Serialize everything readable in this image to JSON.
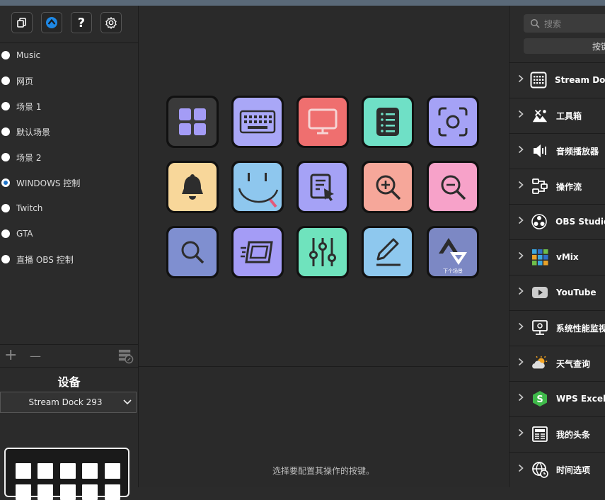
{
  "toolbar": {
    "buttons": [
      {
        "name": "copy-icon"
      },
      {
        "name": "store-icon"
      },
      {
        "name": "help-icon",
        "glyph": "?"
      },
      {
        "name": "gear-icon"
      }
    ]
  },
  "profiles": [
    {
      "label": "Music",
      "selected": false
    },
    {
      "label": "网页",
      "selected": false
    },
    {
      "label": "场景 1",
      "selected": false
    },
    {
      "label": "默认场景",
      "selected": false
    },
    {
      "label": "场景 2",
      "selected": false
    },
    {
      "label": "WINDOWS 控制",
      "selected": true
    },
    {
      "label": "Twitch",
      "selected": false
    },
    {
      "label": "GTA",
      "selected": false
    },
    {
      "label": "直播 OBS 控制",
      "selected": false
    }
  ],
  "profile_actions": {
    "add": "+",
    "remove": "—"
  },
  "device": {
    "title": "设备",
    "selected": "Stream Dock 293"
  },
  "keys": [
    {
      "icon": "grid-icon",
      "color": "#3a3a3a"
    },
    {
      "icon": "keyboard-icon",
      "color": "#a9a7f7"
    },
    {
      "icon": "monitor-icon",
      "color": "#ef6f6f"
    },
    {
      "icon": "list-icon",
      "color": "#6fe0c6"
    },
    {
      "icon": "screenshot-icon",
      "color": "#a5a2f6"
    },
    {
      "icon": "bell-icon",
      "color": "#f8d79a"
    },
    {
      "icon": "smiley-icon",
      "color": "#8ec7ee"
    },
    {
      "icon": "edit-pointer-icon",
      "color": "#a5a2f6"
    },
    {
      "icon": "zoom-in-icon",
      "color": "#f6a79a"
    },
    {
      "icon": "zoom-out-icon",
      "color": "#f7a2c9"
    },
    {
      "icon": "search-icon",
      "color": "#7f8fd0"
    },
    {
      "icon": "fast-window-icon",
      "color": "#a49cf6"
    },
    {
      "icon": "sliders-icon",
      "color": "#6fe3bd"
    },
    {
      "icon": "pencil-icon",
      "color": "#8ec8ee"
    },
    {
      "icon": "next-scene-icon",
      "color": "#7c88c4",
      "label": "下个场景"
    }
  ],
  "center_hint": "选择要配置其操作的按键。",
  "search": {
    "placeholder": "搜索",
    "button_label": "按键"
  },
  "categories": [
    {
      "label": "Stream Dock",
      "icon": "streamdock-icon"
    },
    {
      "label": "工具箱",
      "icon": "toolbox-icon"
    },
    {
      "label": "音频播放器",
      "icon": "speaker-icon"
    },
    {
      "label": "操作流",
      "icon": "flow-icon"
    },
    {
      "label": "OBS Studio",
      "icon": "obs-icon"
    },
    {
      "label": "vMix",
      "icon": "vmix-icon"
    },
    {
      "label": "YouTube",
      "icon": "youtube-icon"
    },
    {
      "label": "系统性能监视",
      "icon": "monitor-icon"
    },
    {
      "label": "天气查询",
      "icon": "weather-icon"
    },
    {
      "label": "WPS Excel",
      "icon": "excel-icon"
    },
    {
      "label": "我的头条",
      "icon": "news-icon"
    },
    {
      "label": "时间选项",
      "icon": "globe-clock-icon"
    }
  ]
}
